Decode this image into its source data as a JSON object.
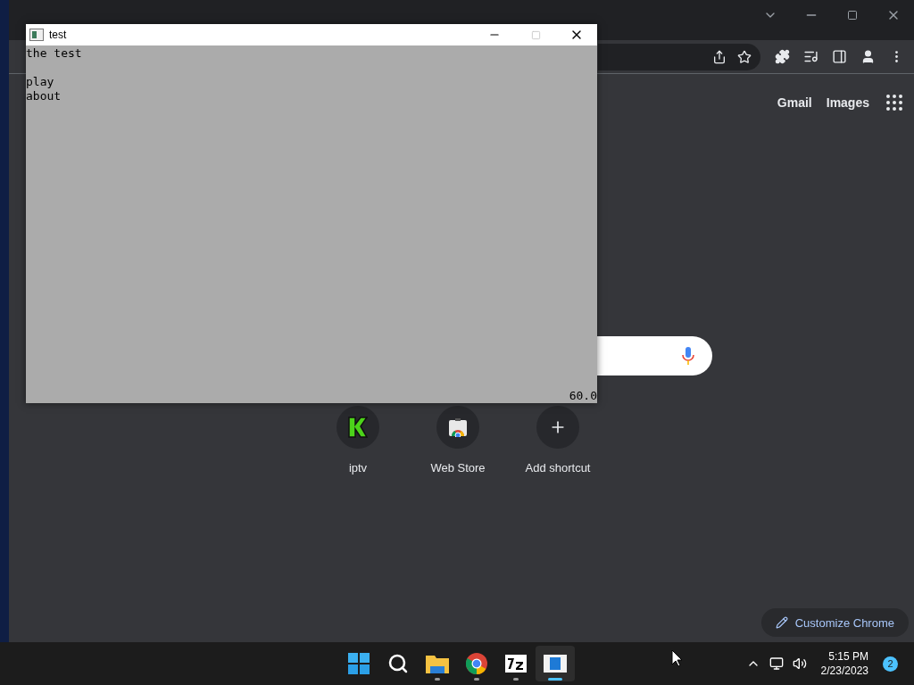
{
  "browser": {
    "header_links": [
      "Gmail",
      "Images"
    ],
    "shortcuts": [
      {
        "label": "iptv",
        "kind": "site"
      },
      {
        "label": "Web Store",
        "kind": "store"
      },
      {
        "label": "Add shortcut",
        "kind": "add"
      }
    ],
    "customize_button": "Customize Chrome"
  },
  "app_window": {
    "title": "test",
    "heading": "the test",
    "menu_items": [
      "play",
      "about"
    ],
    "fps": "60.0"
  },
  "taskbar": {
    "apps": [
      {
        "kind": "start",
        "running": false,
        "active": false
      },
      {
        "kind": "search",
        "running": false,
        "active": false
      },
      {
        "kind": "folder",
        "running": true,
        "active": false
      },
      {
        "kind": "browser",
        "running": true,
        "active": false
      },
      {
        "kind": "archiver",
        "running": true,
        "active": false
      },
      {
        "kind": "app",
        "running": true,
        "active": true
      }
    ],
    "time": "5:15 PM",
    "date": "2/23/2023",
    "notifications": "2"
  }
}
